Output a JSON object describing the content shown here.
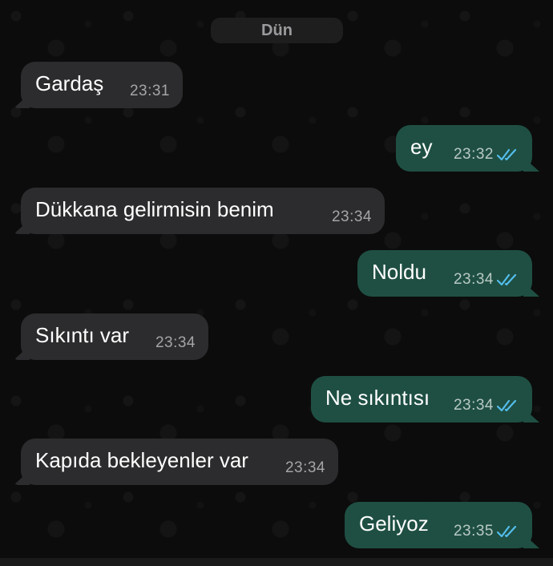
{
  "date_divider": "Dün",
  "colors": {
    "incoming_bubble": "#2c2c2e",
    "outgoing_bubble": "#1f4f43",
    "read_ticks": "#53bdeb"
  },
  "messages": [
    {
      "text": "Gardaş",
      "time": "23:31",
      "direction": "in",
      "ticks": ""
    },
    {
      "text": "ey",
      "time": "23:32",
      "direction": "out",
      "ticks": "double-check-read-icon"
    },
    {
      "text": "Dükkana gelirmisin benim",
      "time": "23:34",
      "direction": "in",
      "ticks": ""
    },
    {
      "text": "Noldu",
      "time": "23:34",
      "direction": "out",
      "ticks": "double-check-read-icon"
    },
    {
      "text": "Sıkıntı var",
      "time": "23:34",
      "direction": "in",
      "ticks": ""
    },
    {
      "text": "Ne sıkıntısı",
      "time": "23:34",
      "direction": "out",
      "ticks": "double-check-read-icon"
    },
    {
      "text": "Kapıda bekleyenler var",
      "time": "23:34",
      "direction": "in",
      "ticks": ""
    },
    {
      "text": "Geliyoz",
      "time": "23:35",
      "direction": "out",
      "ticks": "double-check-read-icon"
    }
  ]
}
